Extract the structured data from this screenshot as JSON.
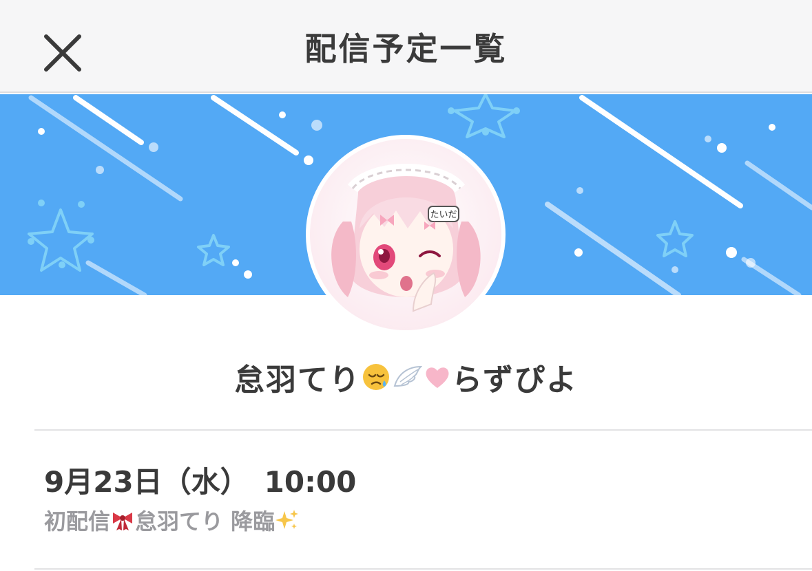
{
  "header": {
    "title": "配信予定一覧",
    "close_icon": "close-icon"
  },
  "banner": {
    "background_color": "#53a9f5",
    "decoration": "stars-and-shooting-lines"
  },
  "channel": {
    "name_part1": "怠羽てり",
    "emoji1": "disappointed-relieved-face",
    "emoji2": "wing",
    "emoji3": "pink-heart",
    "name_part2": "らずぴよ",
    "avatar": "avatar-anime-girl-pink-hair"
  },
  "schedule": [
    {
      "date": "9月23日（水）",
      "time": "10:00",
      "title_part1": "初配信",
      "emoji_ribbon": "ribbon",
      "title_part2": "怠羽てり 降臨",
      "emoji_sparkles": "sparkles"
    }
  ],
  "colors": {
    "header_bg": "#f6f6f7",
    "accent_blue": "#53a9f5",
    "text_dark": "#3a3a3a",
    "text_muted": "#9a9a9e"
  }
}
